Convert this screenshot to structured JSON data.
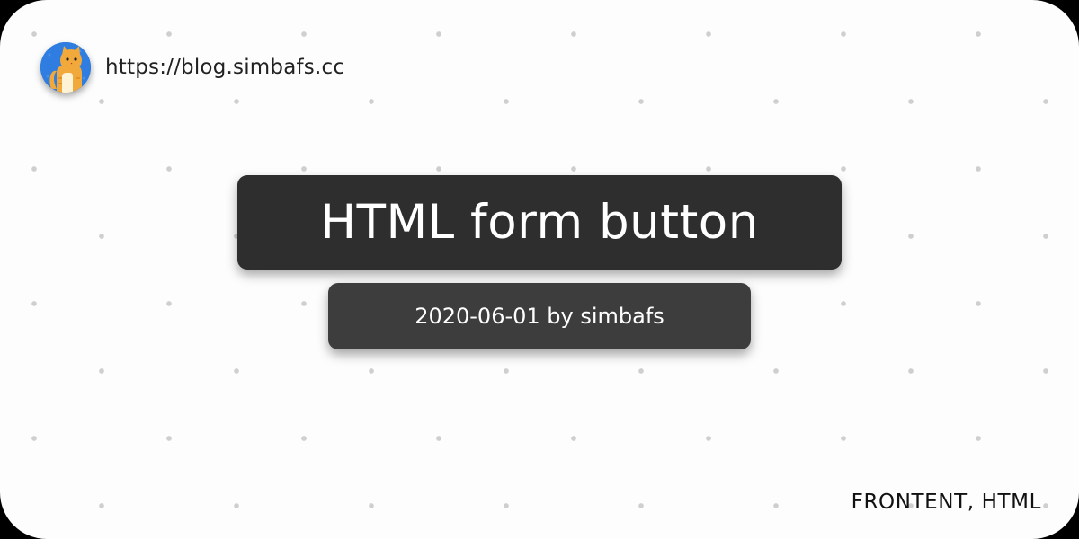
{
  "site": {
    "url": "https://blog.simbafs.cc",
    "avatar_icon": "cat-avatar-icon"
  },
  "post": {
    "title": "HTML form button",
    "meta": "2020-06-01 by simbafs",
    "tags": "FRONTENT, HTML"
  },
  "colors": {
    "background": "#fdfdfd",
    "dots": "#cfcfcf",
    "title_box": "#2e2e2e",
    "meta_box": "#3d3d3d",
    "avatar_bg": "#2f7de0",
    "cat": "#f2a93b"
  }
}
